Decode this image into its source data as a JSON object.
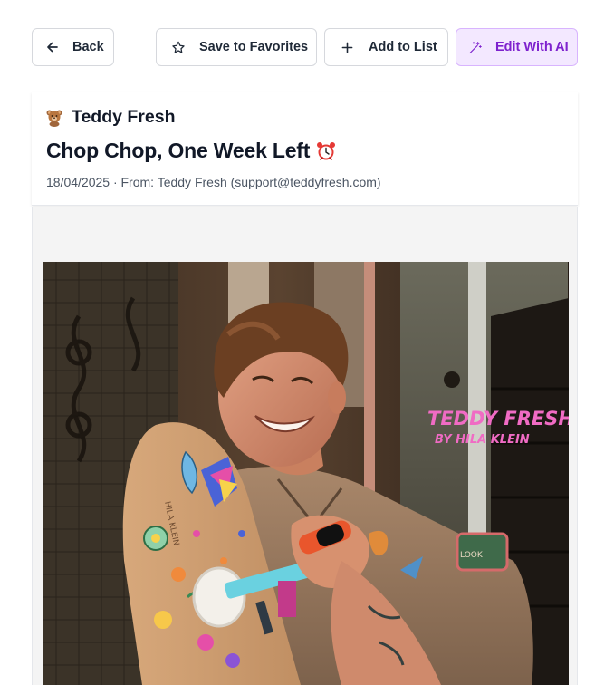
{
  "toolbar": {
    "back_label": "Back",
    "favorites_label": "Save to Favorites",
    "add_list_label": "Add to List",
    "edit_ai_label": "Edit With AI"
  },
  "email": {
    "sender_name": "Teddy Fresh",
    "subject": "Chop Chop, One Week Left",
    "meta": "18/04/2025 · From: Teddy Fresh (support@teddyfresh.com)"
  },
  "hero": {
    "brand_line1": "TEDDY FRESH",
    "brand_line2": "BY HILA KLEIN",
    "patch_text": "LOOK",
    "deck_text": "HILA KLEIN"
  },
  "colors": {
    "ai_button_bg": "#f3e8ff",
    "ai_button_text": "#7e22ce",
    "brand_pink": "#f06bc4"
  },
  "icons": {
    "back": "arrow-left-icon",
    "favorites": "star-outline-icon",
    "add": "plus-icon",
    "ai": "magic-wand-icon",
    "sender": "teddy-bear-emoji",
    "subject": "alarm-clock-emoji"
  }
}
